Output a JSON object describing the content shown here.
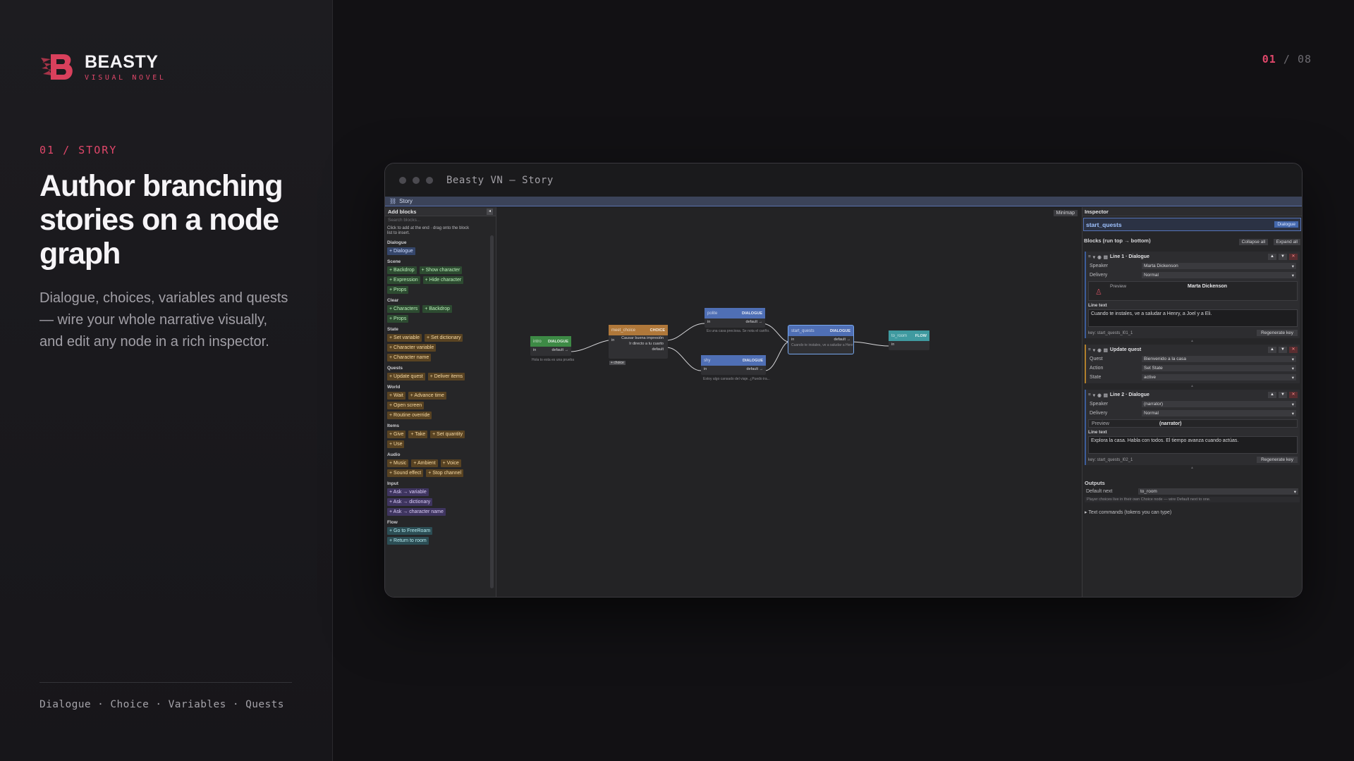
{
  "brand": {
    "name": "BEASTY",
    "tagline": "VISUAL NOVEL",
    "accent": "#e0476a"
  },
  "pager": {
    "current": "01",
    "separator": "/",
    "total": "08"
  },
  "section": {
    "label": "01 / STORY"
  },
  "headline": "Author branching stories on a node graph",
  "description": "Dialogue, choices, variables and quests — wire your whole narrative visually, and edit any node in a rich inspector.",
  "tags": "Dialogue · Choice · Variables · Quests",
  "window": {
    "title": "Beasty VN — Story",
    "tab": "Story"
  },
  "palette": {
    "title": "Add blocks",
    "collapse": "◂",
    "search_placeholder": "Search blocks...",
    "hint": "Click to add at the end · drag onto the block list to insert.",
    "groups": [
      {
        "title": "Dialogue",
        "cls": "c-dialogue",
        "rows": [
          [
            "+ Dialogue"
          ]
        ]
      },
      {
        "title": "Scene",
        "cls": "c-scene",
        "rows": [
          [
            "+ Backdrop",
            "+ Show character"
          ],
          [
            "+ Expression",
            "+ Hide character"
          ],
          [
            "+ Props"
          ]
        ]
      },
      {
        "title": "Clear",
        "cls": "c-clear",
        "rows": [
          [
            "+ Characters",
            "+ Backdrop"
          ],
          [
            "+ Props"
          ]
        ]
      },
      {
        "title": "State",
        "cls": "c-state",
        "rows": [
          [
            "+ Set variable",
            "+ Set dictionary"
          ],
          [
            "+ Character variable"
          ],
          [
            "+ Character name"
          ]
        ]
      },
      {
        "title": "Quests",
        "cls": "c-quests",
        "rows": [
          [
            "+ Update quest",
            "+ Deliver items"
          ]
        ]
      },
      {
        "title": "World",
        "cls": "c-world",
        "rows": [
          [
            "+ Wait",
            "+ Advance time"
          ],
          [
            "+ Open screen"
          ],
          [
            "+ Routine override"
          ]
        ]
      },
      {
        "title": "Items",
        "cls": "c-items",
        "rows": [
          [
            "+ Give",
            "+ Take",
            "+ Set quantity"
          ],
          [
            "+ Use"
          ]
        ]
      },
      {
        "title": "Audio",
        "cls": "c-audio",
        "rows": [
          [
            "+ Music",
            "+ Ambient",
            "+ Voice"
          ],
          [
            "+ Sound effect",
            "+ Stop channel"
          ]
        ]
      },
      {
        "title": "Input",
        "cls": "c-input",
        "rows": [
          [
            "+ Ask → variable"
          ],
          [
            "+ Ask → dictionary"
          ],
          [
            "+ Ask → character name"
          ]
        ]
      },
      {
        "title": "Flow",
        "cls": "c-flow",
        "rows": [
          [
            "+ Go to FreeRoam"
          ],
          [
            "+ Return to room"
          ]
        ]
      }
    ]
  },
  "canvas": {
    "minimap": "Minimap",
    "nodes": {
      "intro": {
        "name": "intro",
        "type": "DIALOGUE",
        "port_in": "in",
        "port_out": "default →",
        "text": "Hola to esta es una prueba",
        "color": "#3d8a45"
      },
      "meet_choice": {
        "name": "meet_choice",
        "type": "CHOICE",
        "port_in": "in",
        "choices": [
          "Causar buena impresión",
          "Ir directo a tu cuarto",
          "default"
        ],
        "add": "+ choice",
        "color": "#b0783a"
      },
      "polite": {
        "name": "polite",
        "type": "DIALOGUE",
        "port_in": "in",
        "port_out": "default →",
        "text": "Es una casa preciosa. Se nota el cariño.",
        "color": "#4f6fb5"
      },
      "shy": {
        "name": "shy",
        "type": "DIALOGUE",
        "port_in": "in",
        "port_out": "default →",
        "text": "Estoy algo cansado del viaje. ¿Puedo ira...",
        "color": "#4f6fb5"
      },
      "start_quests": {
        "name": "start_quests",
        "type": "DIALOGUE",
        "port_in": "in",
        "port_out": "default →",
        "text": "Cuando te instales, ve a saludar a Henry...",
        "color": "#4f6fb5"
      },
      "to_room": {
        "name": "to_room",
        "type": "FLOW",
        "port_in": "in",
        "color": "#3f9aa0"
      }
    }
  },
  "inspector": {
    "title": "Inspector",
    "node_name": "start_quests",
    "node_type": "Dialogue",
    "blocks_title": "Blocks (run top → bottom)",
    "collapse_all": "Collapse all",
    "expand_all": "Expand all",
    "block1": {
      "title": "Line 1 · Dialogue",
      "speaker_label": "Speaker",
      "speaker": "Marta Dickenson",
      "delivery_label": "Delivery",
      "delivery": "Normal",
      "preview_label": "Preview",
      "preview_name": "Marta Dickenson",
      "line_label": "Line text",
      "line_text": "Cuando te instales, ve a saludar a Henry, a Joel y a Eli.",
      "key": "key: start_quests_l01_1",
      "regen": "Regenerate key"
    },
    "block2": {
      "title": "Update quest",
      "quest_label": "Quest",
      "quest": "Bienvenido a la casa",
      "action_label": "Action",
      "action": "Set State",
      "state_label": "State",
      "state": "active"
    },
    "block3": {
      "title": "Line 2 · Dialogue",
      "speaker_label": "Speaker",
      "speaker": "(narrator)",
      "delivery_label": "Delivery",
      "delivery": "Normal",
      "preview_label": "Preview",
      "preview_name": "(narrator)",
      "line_label": "Line text",
      "line_text": "Explora la casa. Habla con todos. El tiempo avanza cuando actúas.",
      "key": "key: start_quests_l02_1",
      "regen": "Regenerate key"
    },
    "outputs": {
      "title": "Outputs",
      "default_label": "Default next",
      "default_value": "to_room",
      "note": "Player choices live in their own Choice node — wire Default next to one."
    },
    "text_commands": "▸ Text commands (tokens you can type)"
  }
}
